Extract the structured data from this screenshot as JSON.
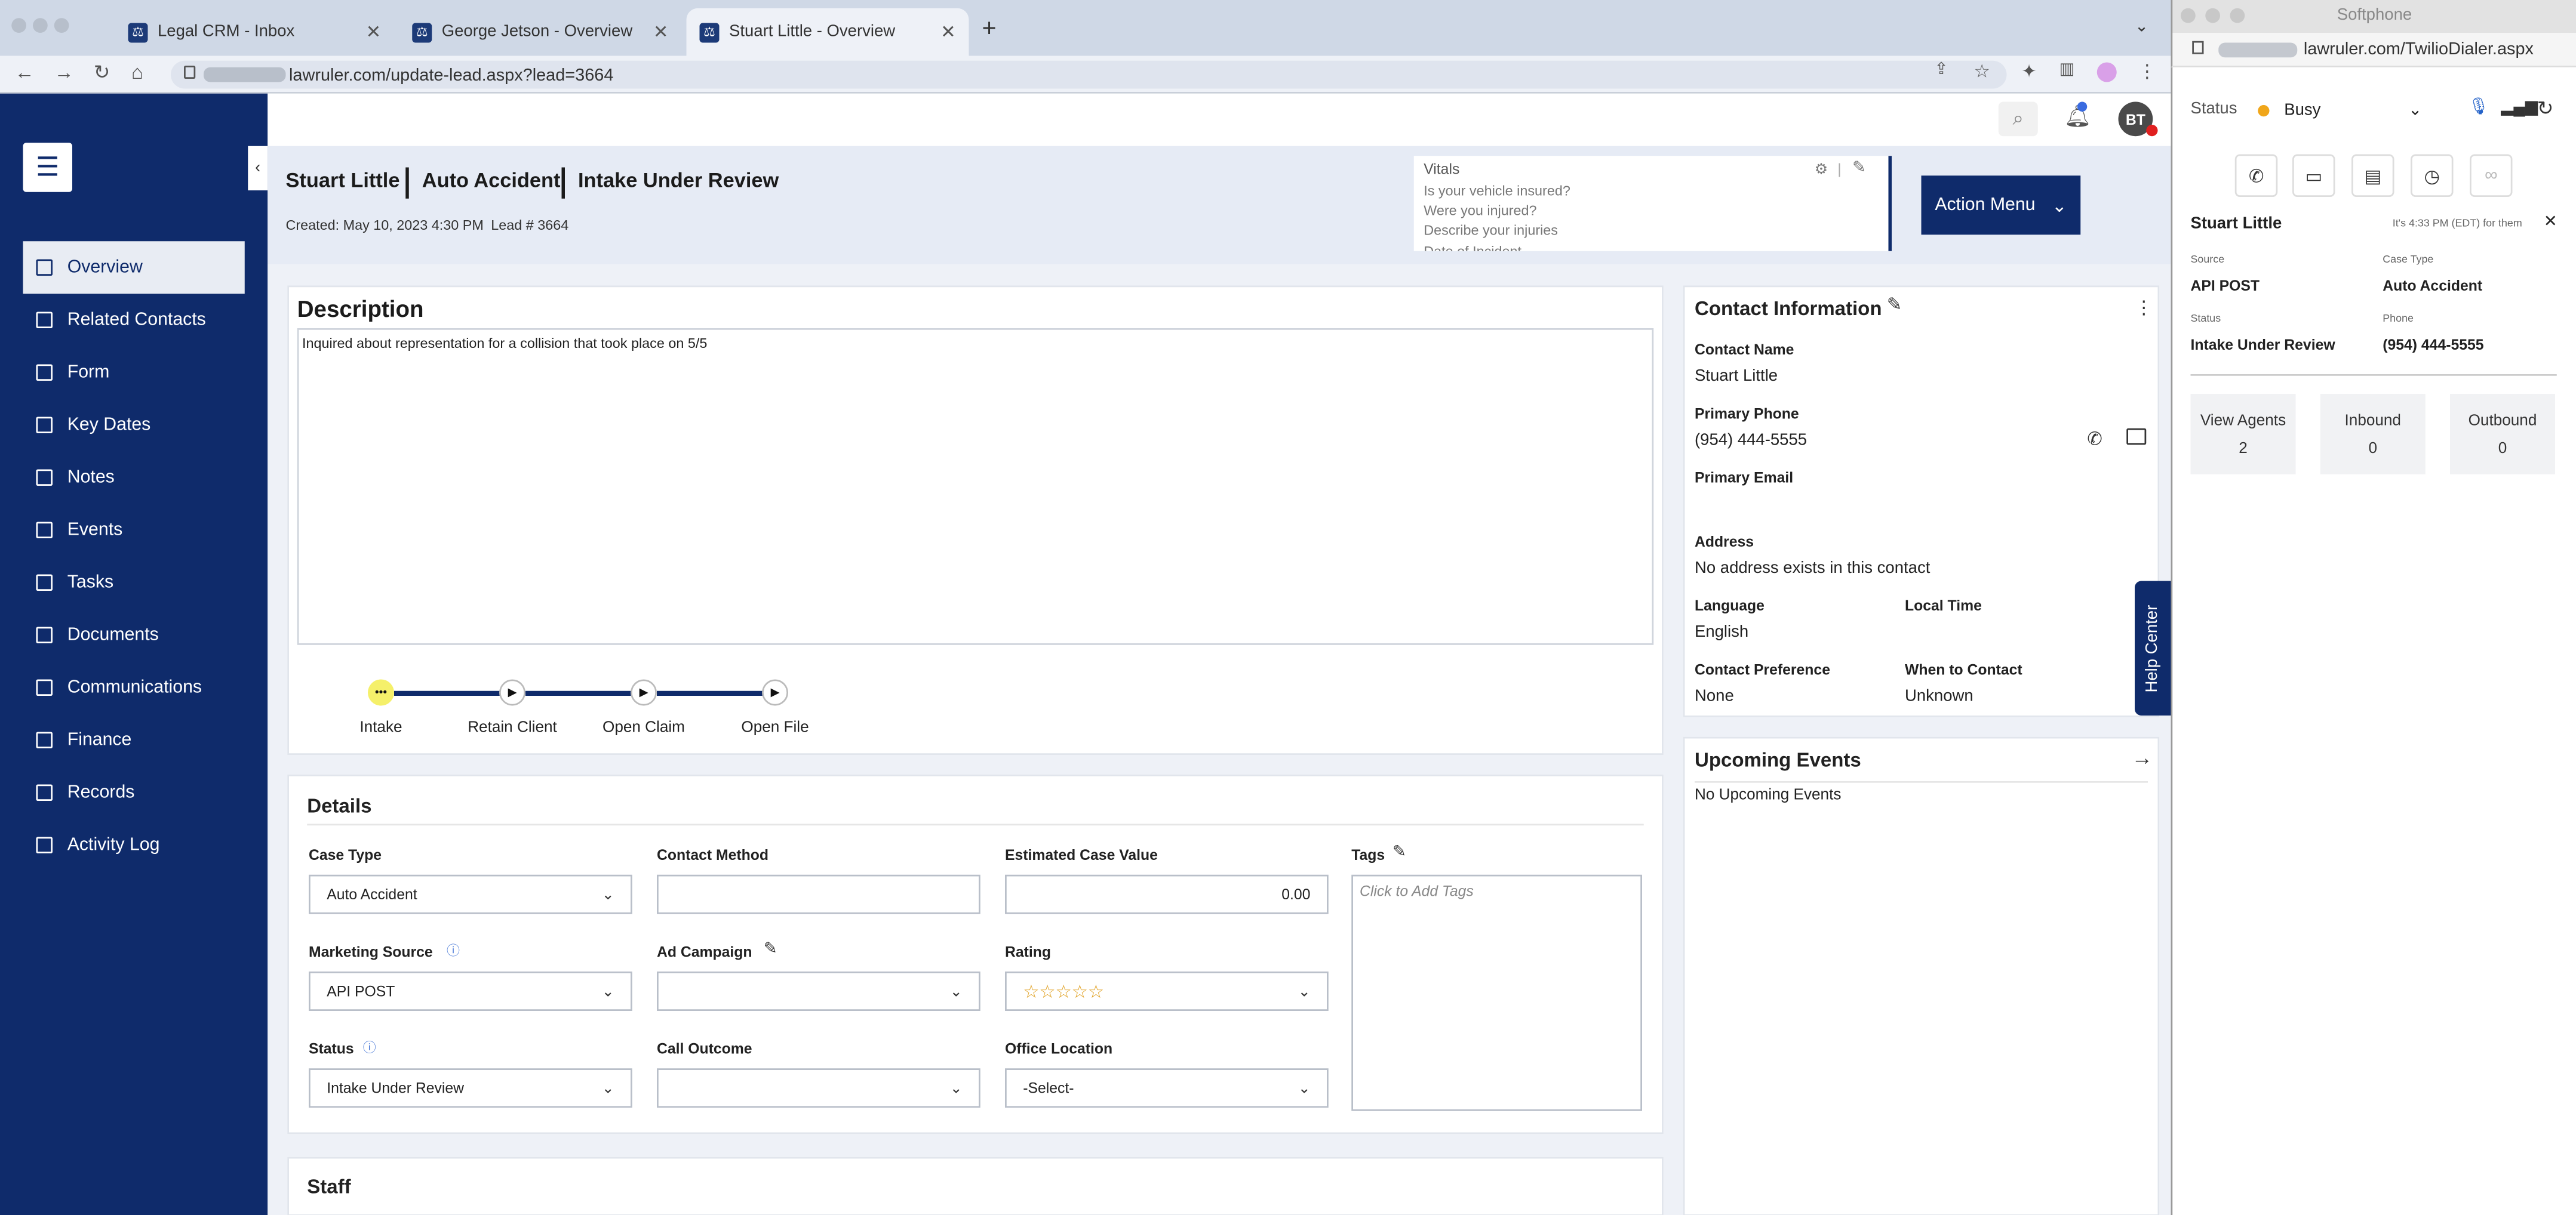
{
  "browser": {
    "tabs": [
      {
        "title": "Legal CRM - Inbox"
      },
      {
        "title": "George Jetson - Overview"
      },
      {
        "title": "Stuart Little - Overview"
      }
    ],
    "url": "lawruler.com/update-lead.aspx?lead=3664"
  },
  "sidebar": {
    "items": [
      {
        "label": "Overview"
      },
      {
        "label": "Related Contacts"
      },
      {
        "label": "Form"
      },
      {
        "label": "Key Dates"
      },
      {
        "label": "Notes"
      },
      {
        "label": "Events"
      },
      {
        "label": "Tasks"
      },
      {
        "label": "Documents"
      },
      {
        "label": "Communications"
      },
      {
        "label": "Finance"
      },
      {
        "label": "Records"
      },
      {
        "label": "Activity Log"
      }
    ]
  },
  "header": {
    "avatar": "BT",
    "name": "Stuart Little",
    "case_type": "Auto Accident",
    "status": "Intake Under Review",
    "created": "Created: May 10, 2023 4:30 PM",
    "lead": "Lead # 3664",
    "vitals_title": "Vitals",
    "vitals": [
      "Is your vehicle insured?",
      "Were you injured?",
      "Describe your injuries",
      "Date of Incident"
    ],
    "action_menu": "Action Menu"
  },
  "description": {
    "title": "Description",
    "text": "Inquired about representation for a collision that took place on 5/5"
  },
  "steps": [
    {
      "label": "Intake"
    },
    {
      "label": "Retain Client"
    },
    {
      "label": "Open Claim"
    },
    {
      "label": "Open File"
    }
  ],
  "details": {
    "title": "Details",
    "case_type_label": "Case Type",
    "case_type": "Auto Accident",
    "contact_method_label": "Contact Method",
    "contact_method": "",
    "est_value_label": "Estimated Case Value",
    "est_value": "0.00",
    "tags_label": "Tags",
    "tags_placeholder": "Click to Add Tags",
    "marketing_source_label": "Marketing Source",
    "marketing_source": "API POST",
    "ad_campaign_label": "Ad Campaign",
    "ad_campaign": "",
    "rating_label": "Rating",
    "rating_stars": "☆☆☆☆☆",
    "status_label": "Status",
    "status": "Intake Under Review",
    "call_outcome_label": "Call Outcome",
    "call_outcome": "",
    "office_location_label": "Office Location",
    "office_location": "-Select-"
  },
  "staff": {
    "title": "Staff"
  },
  "contact": {
    "title": "Contact Information",
    "name_label": "Contact Name",
    "name": "Stuart Little",
    "phone_label": "Primary Phone",
    "phone": "(954) 444-5555",
    "email_label": "Primary Email",
    "email": "",
    "address_label": "Address",
    "address": "No address exists in this contact",
    "language_label": "Language",
    "language": "English",
    "local_time_label": "Local Time",
    "local_time": "",
    "pref_label": "Contact Preference",
    "pref": "None",
    "when_label": "When to Contact",
    "when": "Unknown"
  },
  "upcoming": {
    "title": "Upcoming Events",
    "text": "No Upcoming Events"
  },
  "help_center": "Help Center",
  "softphone": {
    "window_title": "Softphone",
    "url": "lawruler.com/TwilioDialer.aspx",
    "status_label": "Status",
    "status": "Busy",
    "status_color": "#f0a61a",
    "contact_name": "Stuart Little",
    "time_note": "It's 4:33 PM (EDT) for them",
    "source_label": "Source",
    "source": "API POST",
    "case_type_label": "Case Type",
    "case_type": "Auto Accident",
    "status2_label": "Status",
    "status2": "Intake Under Review",
    "phone_label": "Phone",
    "phone": "(954) 444-5555",
    "boxes": [
      {
        "label": "View Agents",
        "value": "2"
      },
      {
        "label": "Inbound",
        "value": "0"
      },
      {
        "label": "Outbound",
        "value": "0"
      }
    ]
  }
}
